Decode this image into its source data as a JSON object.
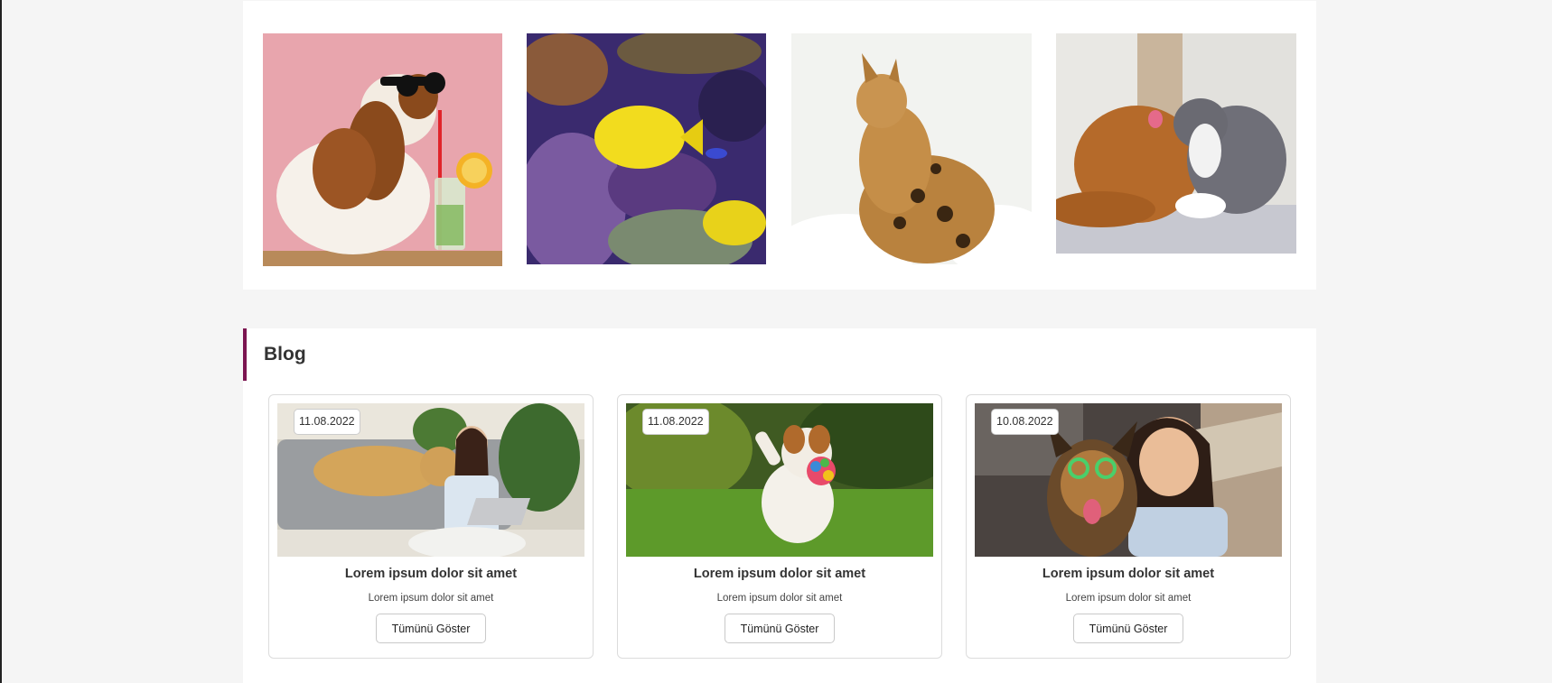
{
  "gallery": {
    "photos": [
      {
        "icon": "dog-with-sunglasses-drink-photo"
      },
      {
        "icon": "yellow-fish-aquarium-photo"
      },
      {
        "icon": "bengal-cat-photo"
      },
      {
        "icon": "dog-and-cat-photo"
      }
    ]
  },
  "blog": {
    "title": "Blog",
    "accent_color": "#7b1450",
    "cards": [
      {
        "date": "11.08.2022",
        "title": "Lorem ipsum dolor sit amet",
        "description": "Lorem ipsum dolor sit amet",
        "button_label": "Tümünü Göster",
        "image_icon": "woman-with-dog-on-sofa-photo"
      },
      {
        "date": "11.08.2022",
        "title": "Lorem ipsum dolor sit amet",
        "description": "Lorem ipsum dolor sit amet",
        "button_label": "Tümünü Göster",
        "image_icon": "dog-running-with-toy-photo"
      },
      {
        "date": "10.08.2022",
        "title": "Lorem ipsum dolor sit amet",
        "description": "Lorem ipsum dolor sit amet",
        "button_label": "Tümünü Göster",
        "image_icon": "woman-selfie-with-dog-photo"
      }
    ]
  }
}
